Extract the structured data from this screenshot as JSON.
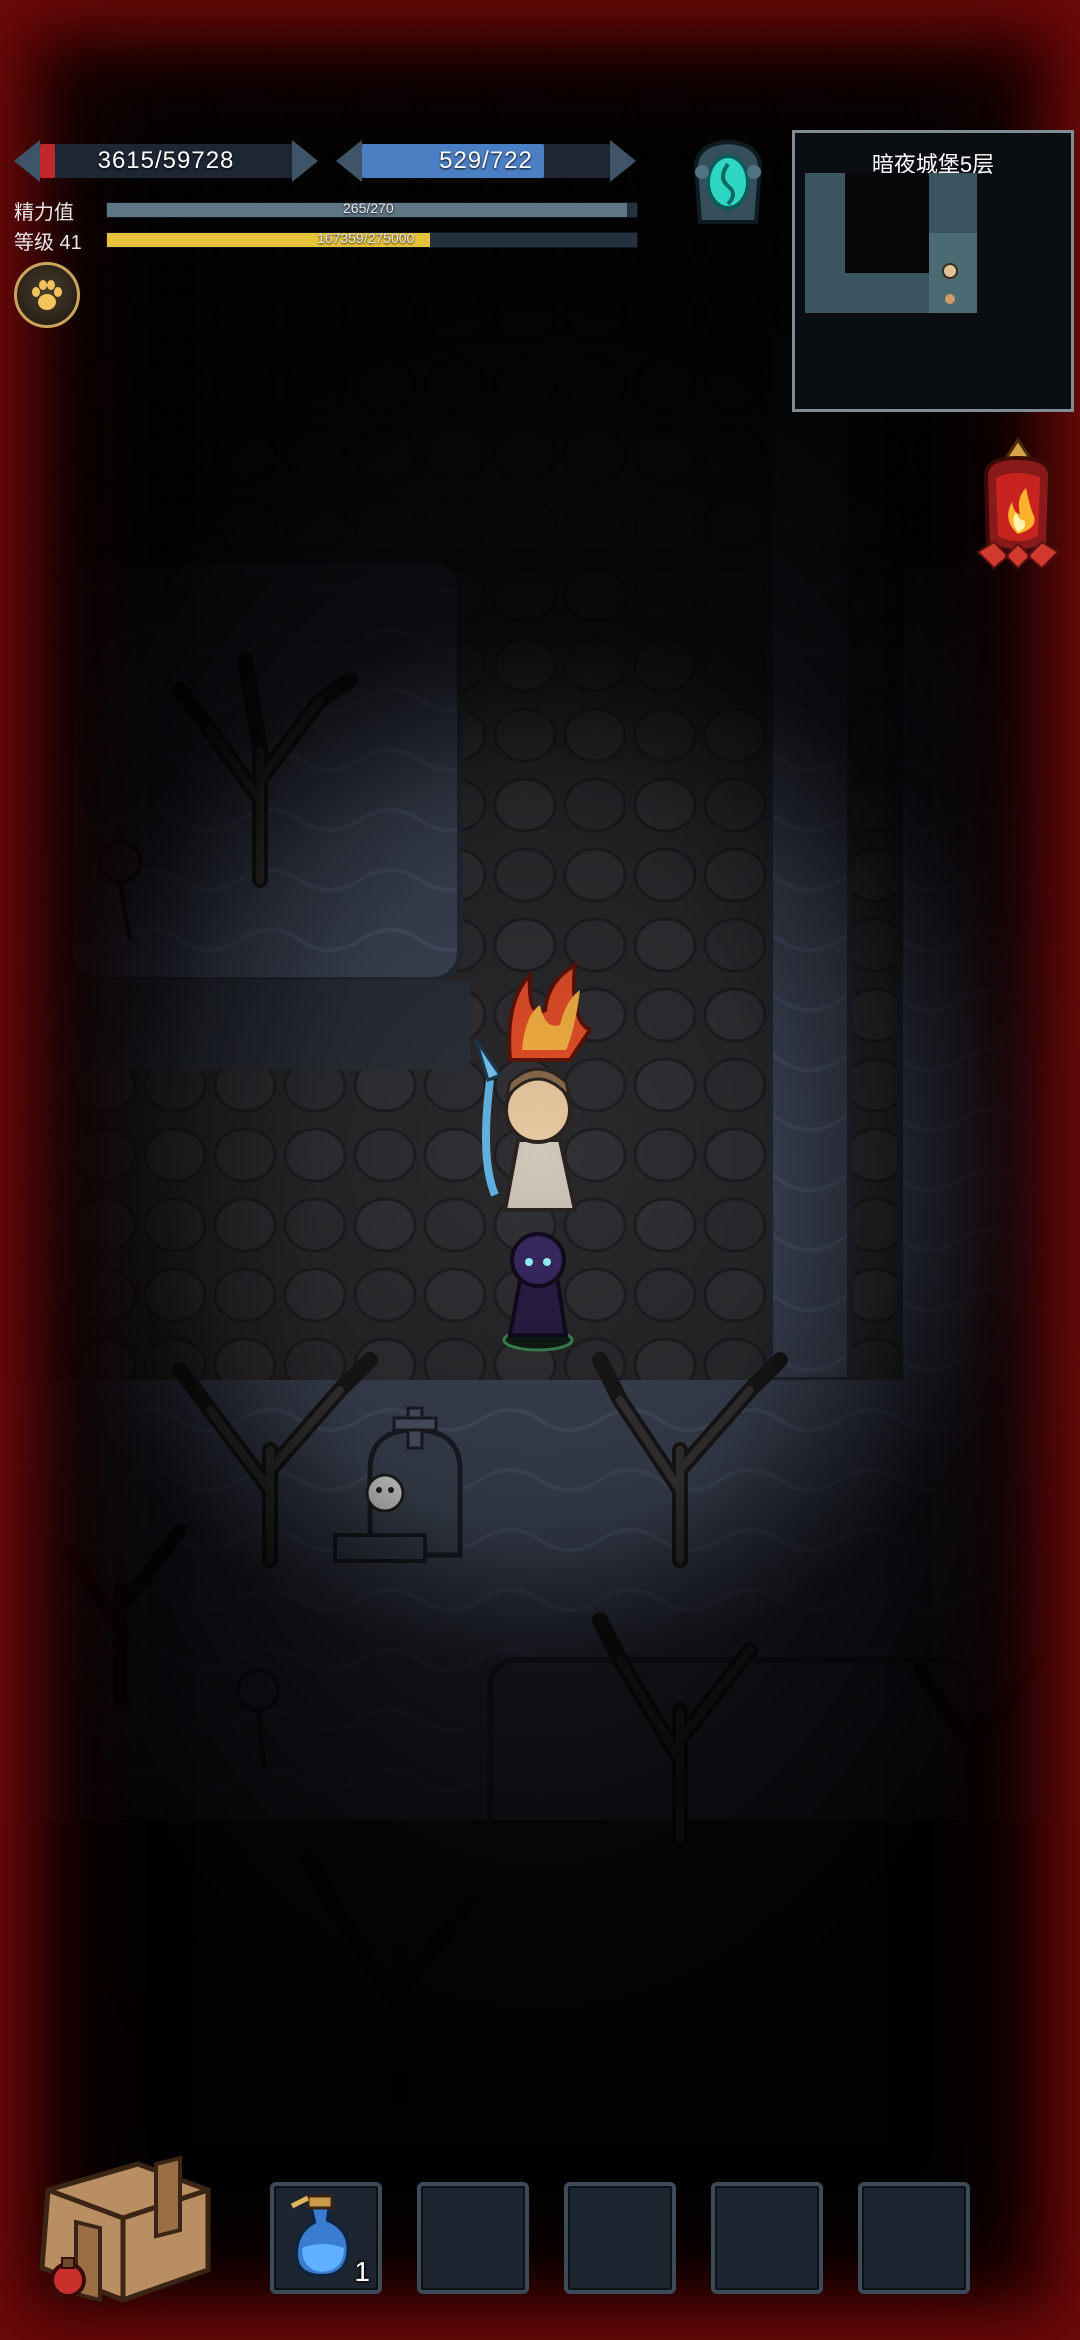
{
  "hud": {
    "hp": {
      "current": 3615,
      "max": 59728,
      "text": "3615/59728",
      "color": "#c0282b"
    },
    "mp": {
      "current": 529,
      "max": 722,
      "text": "529/722",
      "color": "#4b7fc4"
    },
    "energy": {
      "label": "精力值",
      "current": 265,
      "max": 270,
      "text": "265/270",
      "color": "#5f7685"
    },
    "level": {
      "label": "等级 41",
      "exp_text": "167359/275000",
      "exp_current": 167359,
      "exp_max": 275000,
      "color": "#e9c23b"
    }
  },
  "minimap": {
    "title": "暗夜城堡5层"
  },
  "icons": {
    "pet": "paw-icon",
    "portal": "portal-icon",
    "lantern": "fire-lantern-icon",
    "bag": "backpack-icon",
    "potion": "blue-potion-icon"
  },
  "inventory": {
    "slots": [
      {
        "item": "blue-potion",
        "count": "1"
      },
      {
        "item": "",
        "count": ""
      },
      {
        "item": "",
        "count": ""
      },
      {
        "item": "",
        "count": ""
      },
      {
        "item": "",
        "count": ""
      }
    ]
  }
}
